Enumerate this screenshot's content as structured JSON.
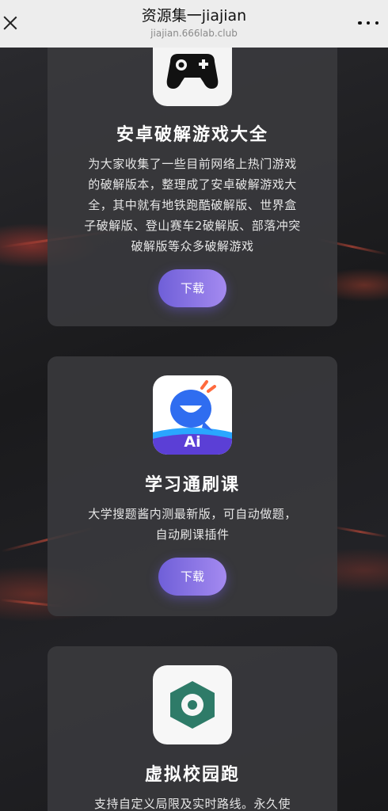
{
  "header": {
    "title": "资源集一jiajian",
    "url": "jiajian.666lab.club"
  },
  "cards": [
    {
      "title": "安卓破解游戏大全",
      "desc_lines": [
        "为大家收集了一些目前网络上热门游戏",
        "的破解版本，整理成了安卓破解游戏大",
        "全，其中就有地铁跑酷破解版、世界盒",
        "子破解版、登山赛车2破解版、部落冲突",
        "破解版等众多破解游戏"
      ],
      "button": "下载",
      "icon": "gamepad-icon"
    },
    {
      "title": "学习通刷课",
      "desc_lines": [
        "大学搜题酱内测最新版，可自动做题，",
        "自动刷课插件"
      ],
      "button": "下载",
      "icon": "ai-mascot-icon",
      "icon_label": "Ai"
    },
    {
      "title": "虚拟校园跑",
      "desc_lines": [
        "支持自定义局限及实时路线。永久使"
      ],
      "icon": "location-hexagon-icon"
    }
  ],
  "colors": {
    "button_start": "#6f5fd8",
    "button_end": "#a48af0",
    "card_bg": "#3a3a3e",
    "hex_icon": "#2e7b68"
  }
}
